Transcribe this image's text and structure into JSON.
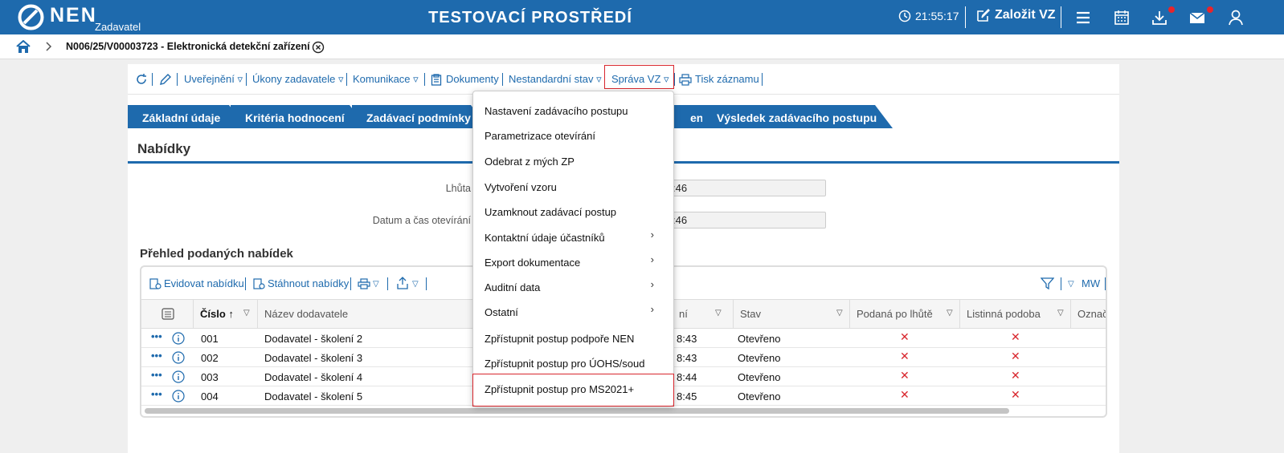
{
  "header": {
    "logo_text": "NEN",
    "logo_sub": "Zadavatel",
    "environment_title": "TESTOVACÍ PROSTŘEDÍ",
    "clock": "21:55:17",
    "create_label": "Založit VZ",
    "brand_color": "#1e6aad",
    "notification_color": "#e8242b"
  },
  "breadcrumb": {
    "title": "N006/25/V00003723 - Elektronická detekční zařízení"
  },
  "toolbar": {
    "items": [
      "Uveřejnění",
      "Úkony zadavatele",
      "Komunikace",
      "Dokumenty",
      "Nestandardní stav",
      "Správa VZ",
      "Tisk záznamu"
    ]
  },
  "tabs": [
    "Základní údaje",
    "Kritéria hodnocení",
    "Zadávací podmínky",
    "ení",
    "Výsledek zadávacího postupu"
  ],
  "section": {
    "title": "Nabídky",
    "field1_label": "Lhůta",
    "field1_value": ":46",
    "field2_label": "Datum a čas otevírání",
    "field2_value": ":46"
  },
  "grid": {
    "title": "Přehled podaných nabídek",
    "toolbar": {
      "register": "Evidovat nabídku",
      "download": "Stáhnout nabídky",
      "mw": "MW"
    },
    "columns": [
      "Číslo",
      "Název dodavatele",
      "ní",
      "Stav",
      "Podaná po lhůtě",
      "Listinná podoba",
      "Označe"
    ],
    "rows": [
      {
        "number": "001",
        "supplier": "Dodavatel - školení 2",
        "time": "8:43",
        "status": "Otevřeno"
      },
      {
        "number": "002",
        "supplier": "Dodavatel - školení 3",
        "time": "8:43",
        "status": "Otevřeno"
      },
      {
        "number": "003",
        "supplier": "Dodavatel - školení 4",
        "time": "8:44",
        "status": "Otevřeno"
      },
      {
        "number": "004",
        "supplier": "Dodavatel - školení 5",
        "time": "8:45",
        "status": "Otevřeno"
      }
    ],
    "cross_mark": "✕"
  },
  "dropdown": {
    "items": [
      "Nastavení zadávacího postupu",
      "Parametrizace otevírání",
      "Odebrat z mých ZP",
      "Vytvoření vzoru",
      "Uzamknout zadávací postup",
      "Kontaktní údaje účastníků",
      "Export dokumentace",
      "Auditní data",
      "Ostatní",
      "Zpřístupnit postup podpoře NEN",
      "Zpřístupnit postup pro ÚOHS/soud",
      "Zpřístupnit postup pro MS2021+"
    ],
    "submenu_chevron": "›"
  },
  "icons": {
    "clock": "clock-icon",
    "edit": "edit-icon",
    "menu": "hamburger-icon",
    "calendar": "calendar-icon",
    "download": "download-icon",
    "mail": "mail-icon",
    "user": "user-icon",
    "home": "home-icon",
    "close": "close-circle-icon",
    "refresh": "refresh-icon",
    "pencil": "pencil-icon",
    "filter": "filter-icon"
  }
}
